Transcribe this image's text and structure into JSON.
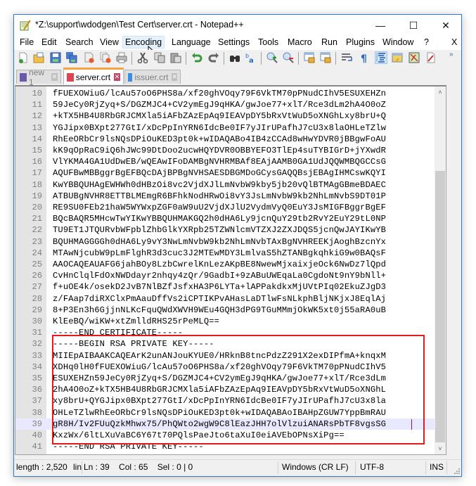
{
  "window": {
    "title": "*Z:\\support\\wdodgen\\Test Cert\\server.crt - Notepad++",
    "controls": {
      "minimize": "—",
      "maximize": "☐",
      "close": "✕"
    }
  },
  "menu": {
    "items": [
      "File",
      "Edit",
      "Search",
      "View",
      "Encoding",
      "Language",
      "Settings",
      "Tools",
      "Macro",
      "Run",
      "Plugins",
      "Window",
      "?"
    ],
    "hovered": "Encoding",
    "close_doc": "X"
  },
  "toolbar": {
    "buttons": [
      "new-file",
      "open-file",
      "save",
      "save-all",
      "close",
      "close-all",
      "print",
      "cut",
      "copy",
      "paste",
      "undo",
      "redo",
      "find",
      "replace",
      "zoom-in",
      "zoom-out",
      "sync-vertical",
      "sync-horizontal",
      "word-wrap",
      "show-all-chars",
      "indent-guide",
      "document-map",
      "function-list",
      "folder-as-workspace"
    ],
    "overflow": "»"
  },
  "tabs": [
    {
      "label": "new 1",
      "active": false,
      "icon_color": "#6a5aa8"
    },
    {
      "label": "server.crt",
      "active": true,
      "icon_color": "#e0454f"
    },
    {
      "label": "issuer.crt",
      "active": false,
      "icon_color": "#3d8ee0"
    }
  ],
  "editor": {
    "current_line": 39,
    "lines": [
      {
        "n": "10",
        "t": "fFUEXOWiuG/lcAu57oO6PHS8a/xf20ghVOqy79F6VkTM70pPNudCIhV5ESUXEHZn"
      },
      {
        "n": "11",
        "t": "59JeCy0RjZyq+S/DGZMJC4+CV2ymEgJ9qHKA/gwJoe77+xlT/Rce3dLm2hA4O0oZ"
      },
      {
        "n": "12",
        "t": "+kTX5HB4U8RbGRJCMXla5iAFbZAzEpAq9IEAVpDY5bRxVtWuD5oXNGhLxy8brU+Q"
      },
      {
        "n": "13",
        "t": "YGJipx0BXpt277GtI/xDcPpInYRN6IdcBe0IF7yJIrUPafhJ7cU3x8laOHLeTZlw"
      },
      {
        "n": "14",
        "t": "RhEeORbCr9lsNQsDPiOuKED3pt0k+wIDAQABo4IB4zCCAd8wHwYDVR0jBBgwFoAU"
      },
      {
        "n": "15",
        "t": "kK9qOpRaC9iQ6hJWc99DtDoo2ucwHQYDVR0OBBYEFO3TlEp4suTYBIGrD+jYXwdR"
      },
      {
        "n": "16",
        "t": "VlYKMA4GA1UdDwEB/wQEAwIFoDAMBgNVHRMBAf8EAjAAMB0GA1UdJQQWMBQGCCsG"
      },
      {
        "n": "17",
        "t": "AQUFBwMBBggrBgEFBQcDAjBPBgNVHSAESDBGMDoGCysGAQQBsjEBAgIHMCswKQYI"
      },
      {
        "n": "18",
        "t": "KwYBBQUHAgEWHWh0dHBzOi8vc2VjdXJlLmNvbW9kby5jb20vQlBTMAgGBmeBDAEC"
      },
      {
        "n": "19",
        "t": "ATBUBgNVHR8ETTBLMEmgR6BFhkNodHRwOi8vY3JsLmNvbW9kb2NhLmNvbS9DT01P"
      },
      {
        "n": "20",
        "t": "RE9SU0FEb21haW5WYWxpZGF0aW9uU2VjdXJlU2VydmVyQ0EuY3JsMIGFBggrBgEF"
      },
      {
        "n": "21",
        "t": "BQcBAQR5MHcwTwYIKwYBBQUHMAKGQ2h0dHA6Ly9jcnQuY29tb2RvY2EuY29tL0NP"
      },
      {
        "n": "22",
        "t": "TU9ET1JTQURvbWFpblZhbGlkYXRpb25TZWNlcmVTZXJ2ZXJDQS5jcnQwJAYIKwYB"
      },
      {
        "n": "23",
        "t": "BQUHMAGGGGh0dHA6Ly9vY3NwLmNvbW9kb2NhLmNvbTAxBgNVHREEKjAoghBzcnYx"
      },
      {
        "n": "24",
        "t": "MTAwNjcubW9pLmFlghR3d3cuc3J2MTEwMDY3LmlvaS5hZTANBgkqhkiG9w0BAQsF"
      },
      {
        "n": "25",
        "t": "AAOCAQEAUAFG6jahBOy8LzbCwrelKnLezAKpBE8NwewMjxaixjeOck6NwDz7lQpd"
      },
      {
        "n": "26",
        "t": "CvHnClqlFdOxNWDdayr2nhqy4zQr/9GadbI+9zABuUWEqaLa0CgdoNt9nY9bNll+"
      },
      {
        "n": "27",
        "t": "f+uOE4k/osekD2JvB7NlBZfJsfxHA3P6LYTa+lAPPakdkxMjUVtPIq02EkuZJgD3"
      },
      {
        "n": "28",
        "t": "z/FAap7diRXClxPmAauDffVs2iCPTIKPvAHasLaDTlwFsNLkphBljNKjxJ8EqlAj"
      },
      {
        "n": "29",
        "t": "8+P3En3h6GjjnNLKcFquQWdXWVH9WEu4GQH3dPG9TGuMMmjOkWK5xt0j55aRA0uB"
      },
      {
        "n": "30",
        "t": "KlEeBQ/wiKW+xtZmlldRHS25rPeMLQ=="
      },
      {
        "n": "31",
        "t": "-----END CERTIFICATE-----"
      },
      {
        "n": "32",
        "t": "-----BEGIN RSA PRIVATE KEY-----"
      },
      {
        "n": "33",
        "t": "MIIEpAIBAAKCAQEArK2unANJouKYUE0/HRknB8tncPdzZ291X2exDIPfmA+knqxM"
      },
      {
        "n": "34",
        "t": "XDHq0lH0fFUEXOWiuG/lcAu57oO6PHS8a/xf20ghVOqy79F6VkTM70pPNudCIhV5"
      },
      {
        "n": "35",
        "t": "ESUXEHZn59JeCy0RjZyq+S/DGZMJC4+CV2ymEgJ9qHKA/gwJoe77+xlT/Rce3dLm"
      },
      {
        "n": "36",
        "t": "2hA4O0oZ+kTX5HB4U8RbGRJCMXla5iAFbZAzEpAq9IEAVpDY5bRxVtWuD5oXNGhL"
      },
      {
        "n": "37",
        "t": "xy8brU+QYGJipx0BXpt277GtI/xDcPpInYRN6IdcBe0IF7yJIrUPafhJ7cU3x8la"
      },
      {
        "n": "38",
        "t": "OHLeTZlwRhEeORbCr9lsNQsDPiOuKED3pt0k+wIDAQABAoIBAHpZGUW7YppBmRAU"
      },
      {
        "n": "39",
        "t": "gR8H/Iv2FUuQzkMhwx75/PhQWto2wgW9C8lEazJHH7olVlzuiANARsPbTF8vgsSG"
      },
      {
        "n": "40",
        "t": "KxzWx/6ltLXuVaBC6Y67t70PQlsPaeJto6taXuI0eiAVEbOPNsXiPg=="
      },
      {
        "n": "41",
        "t": "-----END RSA PRIVATE KEY-----"
      }
    ]
  },
  "scrollbar": {
    "up": "˄",
    "down": "˅"
  },
  "statusbar": {
    "length": "length : 2,520",
    "lines_truncated": "lin",
    "position": "Ln : 39    Col : 65    Sel : 0 | 0",
    "eol": "Windows (CR LF)",
    "encoding": "UTF-8",
    "mode": "INS"
  }
}
